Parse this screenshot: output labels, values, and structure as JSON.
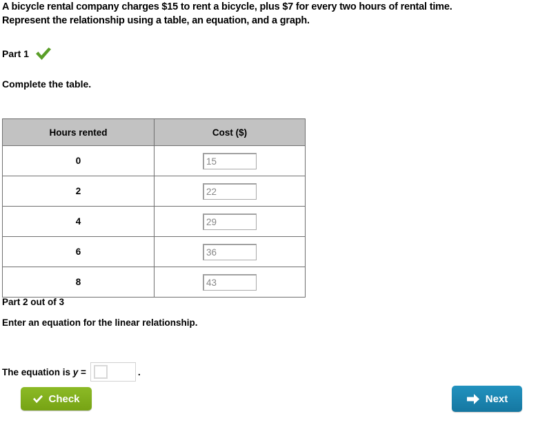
{
  "problem": {
    "line1": "A bicycle rental company charges $15 to rent a bicycle, plus $7 for every two hours of rental time.",
    "line2": "Represent the relationship using a table, an equation, and a graph."
  },
  "part1": {
    "label": "Part 1",
    "status_icon": "green-check-icon",
    "instruction": "Complete the table."
  },
  "table": {
    "headers": [
      "Hours rented",
      "Cost ($)"
    ],
    "rows": [
      {
        "hours": "0",
        "cost": "15"
      },
      {
        "hours": "2",
        "cost": "22"
      },
      {
        "hours": "4",
        "cost": "29"
      },
      {
        "hours": "6",
        "cost": "36"
      },
      {
        "hours": "8",
        "cost": "43"
      }
    ]
  },
  "part2": {
    "label": "Part 2 out of 3",
    "instruction": "Enter an equation for the linear relationship.",
    "equation_prefix": "The equation is ",
    "equation_variable": "y",
    "equation_equals": " = ",
    "equation_value": "",
    "equation_period": "."
  },
  "buttons": {
    "check_label": "Check",
    "check_icon": "check-icon",
    "check_color": "#7aab1b",
    "next_label": "Next",
    "next_icon": "arrow-right-icon",
    "next_color": "#1b86b4"
  },
  "colors": {
    "table_header_bg": "#c2c2c2",
    "table_border": "#6f6f6f",
    "input_text": "#878787",
    "check_mark_green": "#5a9e28"
  }
}
